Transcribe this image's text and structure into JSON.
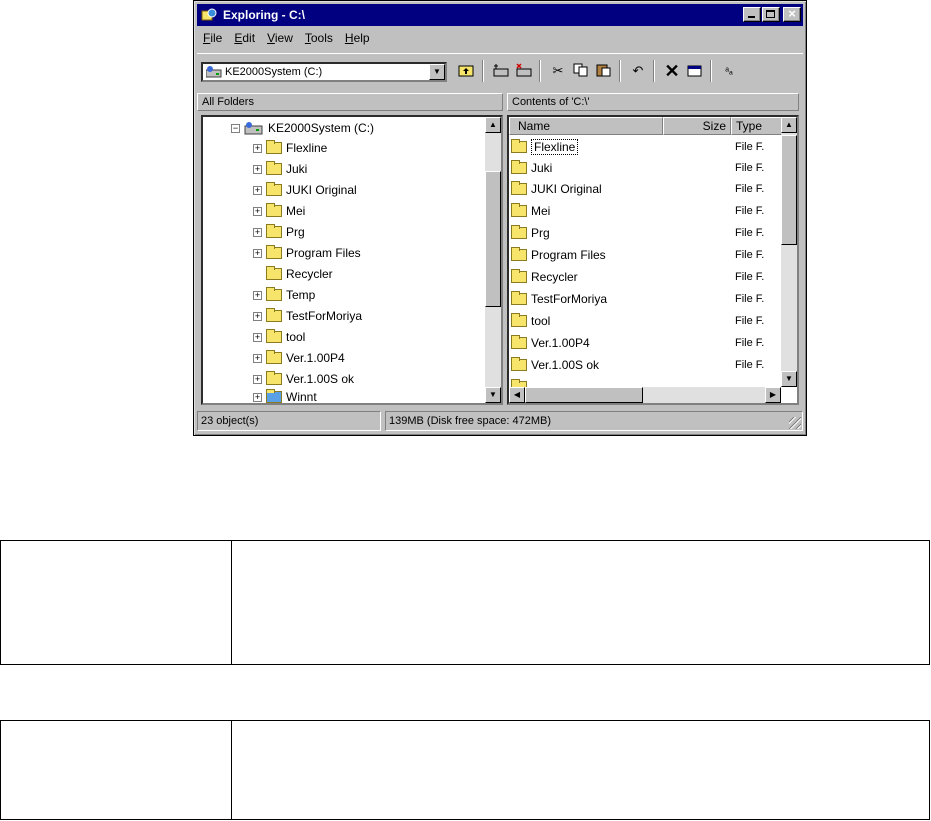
{
  "window": {
    "title": "Exploring - C:\\",
    "icon": "explorer-icon",
    "buttons": [
      "minimize-icon",
      "maximize-icon",
      "close-icon"
    ]
  },
  "menu": [
    {
      "accel": "F",
      "rest": "ile"
    },
    {
      "accel": "E",
      "rest": "dit"
    },
    {
      "accel": "V",
      "rest": "iew"
    },
    {
      "accel": "T",
      "rest": "ools"
    },
    {
      "accel": "H",
      "rest": "elp"
    }
  ],
  "toolbar": {
    "address": "KE2000System (C:)",
    "buttons": [
      "up-folder-icon",
      "map-drive-icon",
      "disconnect-drive-icon",
      "cut-icon",
      "copy-icon",
      "paste-icon",
      "undo-icon",
      "delete-icon",
      "properties-icon",
      "large-icons-icon"
    ]
  },
  "left_pane": {
    "header": "All Folders",
    "root": "KE2000System (C:)",
    "folders": [
      {
        "name": "Flexline",
        "expandable": true
      },
      {
        "name": "Juki",
        "expandable": true
      },
      {
        "name": "JUKI Original",
        "expandable": true
      },
      {
        "name": "Mei",
        "expandable": true
      },
      {
        "name": "Prg",
        "expandable": true
      },
      {
        "name": "Program Files",
        "expandable": true
      },
      {
        "name": "Recycler",
        "expandable": false
      },
      {
        "name": "Temp",
        "expandable": true
      },
      {
        "name": "TestForMoriya",
        "expandable": true
      },
      {
        "name": "tool",
        "expandable": true
      },
      {
        "name": "Ver.1.00P4",
        "expandable": true
      },
      {
        "name": "Ver.1.00S ok",
        "expandable": true
      },
      {
        "name": "Winnt",
        "expandable": true
      }
    ]
  },
  "right_pane": {
    "header": "Contents of 'C:\\'",
    "columns": [
      "Name",
      "Size",
      "Type"
    ],
    "items": [
      {
        "name": "Flexline",
        "type": "File F."
      },
      {
        "name": "Juki",
        "type": "File F."
      },
      {
        "name": "JUKI Original",
        "type": "File F."
      },
      {
        "name": "Mei",
        "type": "File F."
      },
      {
        "name": "Prg",
        "type": "File F."
      },
      {
        "name": "Program Files",
        "type": "File F."
      },
      {
        "name": "Recycler",
        "type": "File F."
      },
      {
        "name": "TestForMoriya",
        "type": "File F."
      },
      {
        "name": "tool",
        "type": "File F."
      },
      {
        "name": "Ver.1.00P4",
        "type": "File F."
      },
      {
        "name": "Ver.1.00S ok",
        "type": "File F."
      }
    ]
  },
  "status": {
    "objects": "23 object(s)",
    "space": "139MB (Disk free space: 472MB)"
  }
}
